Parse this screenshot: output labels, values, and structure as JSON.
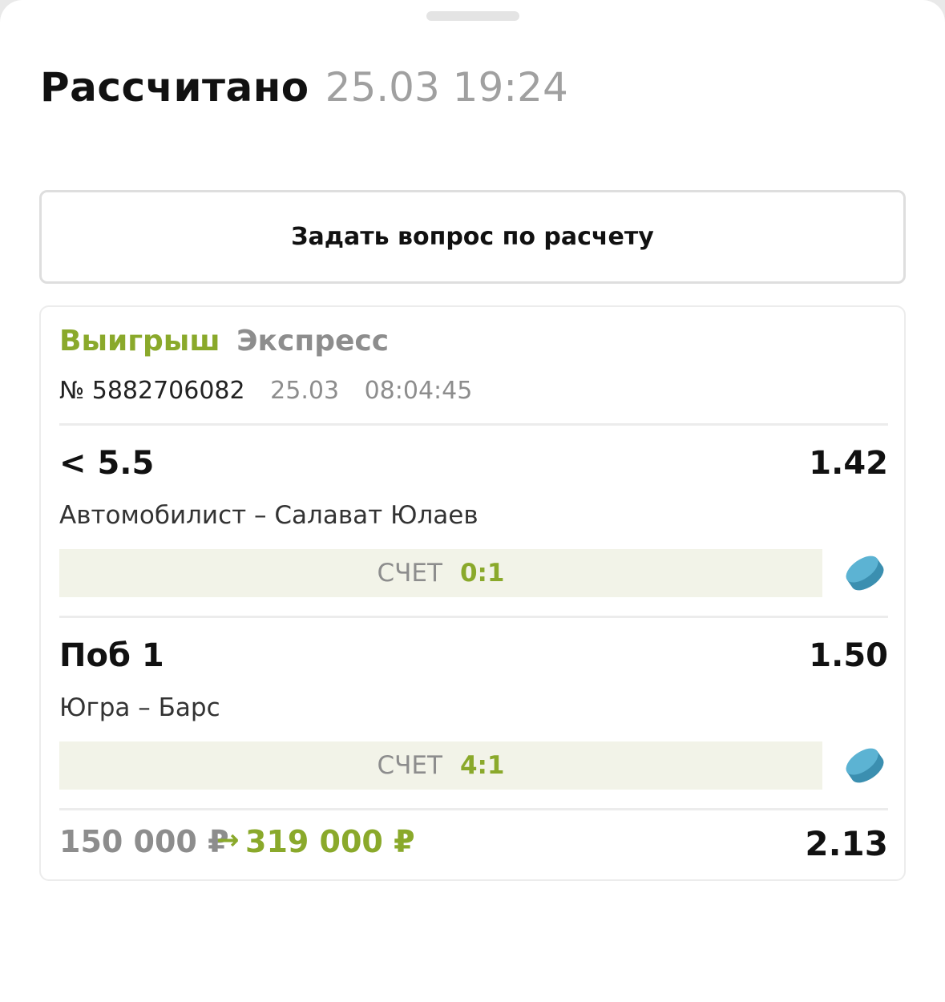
{
  "header": {
    "title": "Рассчитано",
    "date": "25.03 19:24"
  },
  "ask_button": "Задать вопрос по расчету",
  "bet": {
    "status": "Выигрыш",
    "type": "Экспресс",
    "number": "№ 5882706082",
    "date": "25.03",
    "time": "08:04:45",
    "events": [
      {
        "outcome": "< 5.5",
        "odds": "1.42",
        "teams": "Автомобилист – Салават Юлаев",
        "score_label": "СЧЕТ",
        "score": "0:1",
        "sport_icon": "hockey-puck-icon"
      },
      {
        "outcome": "Поб 1",
        "odds": "1.50",
        "teams": "Югра – Барс",
        "score_label": "СЧЕТ",
        "score": "4:1",
        "sport_icon": "hockey-puck-icon"
      }
    ],
    "stake": "150 000 ₽",
    "arrow": "→",
    "payout": "319 000 ₽",
    "total_odds": "2.13"
  },
  "colors": {
    "win_green": "#8aa92b",
    "puck_blue": "#4fa6c8",
    "muted_gray": "#8d8d8d",
    "score_bg": "#f2f3e8"
  }
}
